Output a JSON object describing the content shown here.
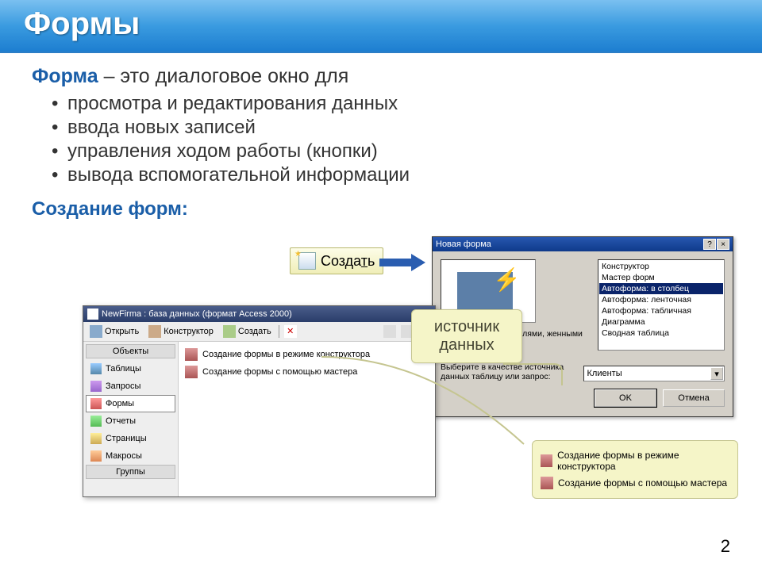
{
  "header": {
    "title": "Формы"
  },
  "definition": {
    "term": "Форма",
    "text": " – это диалоговое окно для",
    "bullets": [
      "просмотра и редактирования данных",
      "ввода новых записей",
      "управления ходом работы (кнопки)",
      "вывода вспомогательной информации"
    ]
  },
  "subheading": "Создание форм:",
  "create_button": "Создать",
  "new_form_dialog": {
    "title": "Новая форма",
    "help_btn": "?",
    "close_btn": "×",
    "options": [
      "Конструктор",
      "Мастер форм",
      "Автоформа: в столбец",
      "Автоформа: ленточная",
      "Автоформа: табличная",
      "Диаграмма",
      "Сводная таблица"
    ],
    "selected_index": 2,
    "description": "ическое создание\nполями,\nженными в один\nко столбцов.",
    "source_label": "Выберите в качестве источника данных таблицу или запрос:",
    "combo_value": "Клиенты",
    "ok": "OK",
    "cancel": "Отмена"
  },
  "db_window": {
    "title": "NewFirma : база данных (формат Access 2000)",
    "toolbar": {
      "open": "Открыть",
      "design": "Конструктор",
      "create": "Создать"
    },
    "sidebar": {
      "objects_label": "Объекты",
      "groups_label": "Группы",
      "items": [
        "Таблицы",
        "Запросы",
        "Формы",
        "Отчеты",
        "Страницы",
        "Макросы"
      ],
      "selected_index": 2
    },
    "main_actions": [
      "Создание формы в режиме конструктора",
      "Создание формы с помощью мастера"
    ]
  },
  "callout_source": "источник данных",
  "callout_actions": [
    "Создание формы в режиме конструктора",
    "Создание формы с помощью мастера"
  ],
  "page_number": "2"
}
